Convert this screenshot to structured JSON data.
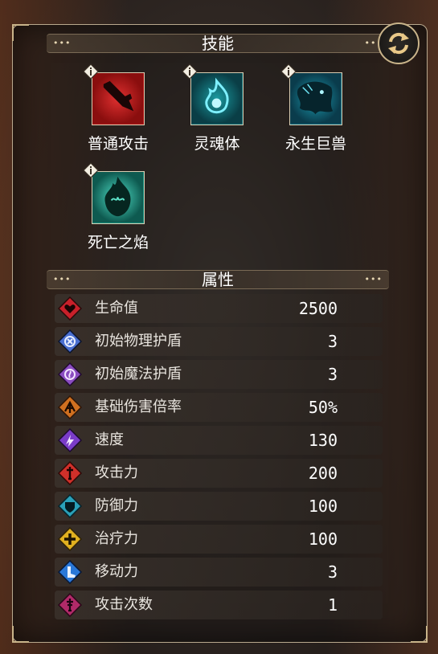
{
  "skills_section": {
    "title": "技能",
    "dots_left": "•••",
    "dots_right": "•••",
    "skills": [
      {
        "label": "普通攻击",
        "icon": "normal-attack-icon",
        "bg": "#b01818"
      },
      {
        "label": "灵魂体",
        "icon": "soul-body-icon",
        "bg": "#0f6f78"
      },
      {
        "label": "永生巨兽",
        "icon": "immortal-beast-icon",
        "bg": "#0d6f86"
      },
      {
        "label": "死亡之焰",
        "icon": "death-flame-icon",
        "bg": "#1a8f80"
      }
    ]
  },
  "attributes_section": {
    "title": "属性",
    "dots_left": "•••",
    "dots_right": "•••",
    "stats": [
      {
        "label": "生命值",
        "value": "2500",
        "icon": "heart-icon",
        "color": "#c8202a"
      },
      {
        "label": "初始物理护盾",
        "value": "3",
        "icon": "physical-shield-icon",
        "color": "#4a6fd0"
      },
      {
        "label": "初始魔法护盾",
        "value": "3",
        "icon": "magic-shield-icon",
        "color": "#8a4cc0"
      },
      {
        "label": "基础伤害倍率",
        "value": "50%",
        "icon": "damage-rate-icon",
        "color": "#d07020"
      },
      {
        "label": "速度",
        "value": "130",
        "icon": "speed-icon",
        "color": "#7a3cc8"
      },
      {
        "label": "攻击力",
        "value": "200",
        "icon": "attack-icon",
        "color": "#d0302a"
      },
      {
        "label": "防御力",
        "value": "100",
        "icon": "defense-icon",
        "color": "#2aa0b8"
      },
      {
        "label": "治疗力",
        "value": "100",
        "icon": "heal-icon",
        "color": "#e0b020"
      },
      {
        "label": "移动力",
        "value": "3",
        "icon": "move-icon",
        "color": "#2a78d8"
      },
      {
        "label": "攻击次数",
        "value": "1",
        "icon": "attack-count-icon",
        "color": "#b02a68"
      }
    ]
  }
}
